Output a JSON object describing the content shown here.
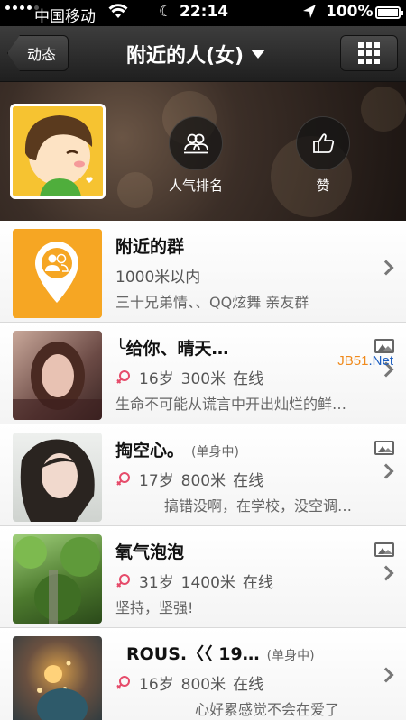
{
  "status_bar": {
    "carrier": "中国移动",
    "time": "22:14",
    "battery": "100%"
  },
  "nav": {
    "back_label": "动态",
    "title": "附近的人(女)"
  },
  "header": {
    "actions": [
      {
        "label": "人气排名",
        "icon": "ranking-people-icon"
      },
      {
        "label": "赞",
        "icon": "thumbs-up-icon"
      }
    ]
  },
  "group_row": {
    "name": "附近的群",
    "distance": "1000米以内",
    "desc": "三十兄弟情、、QQ炫舞 亲友群"
  },
  "people": [
    {
      "name": "╰给你、晴天…",
      "tag": "",
      "age": "16岁",
      "distance": "300米",
      "status": "在线",
      "signature": "生命不可能从谎言中开出灿烂的鲜…",
      "has_photos": true
    },
    {
      "name": "掏空心。",
      "tag": "(单身中)",
      "age": "17岁",
      "distance": "800米",
      "status": "在线",
      "signature": "搞错没啊，在学校，没空调…",
      "has_photos": true
    },
    {
      "name": "氧气泡泡",
      "tag": "",
      "age": "31岁",
      "distance": "1400米",
      "status": "在线",
      "signature": "坚持，坚强!",
      "has_photos": true
    },
    {
      "name": "ROUS.〈〈 19…",
      "tag": "(单身中)",
      "age": "16岁",
      "distance": "800米",
      "status": "在线",
      "signature": "心好累感觉不会在爱了",
      "has_photos": false
    }
  ],
  "watermark": {
    "left": "JB51",
    "right": ".Net"
  },
  "colors": {
    "female": "#e64b6a",
    "group_orange": "#f6a623"
  }
}
